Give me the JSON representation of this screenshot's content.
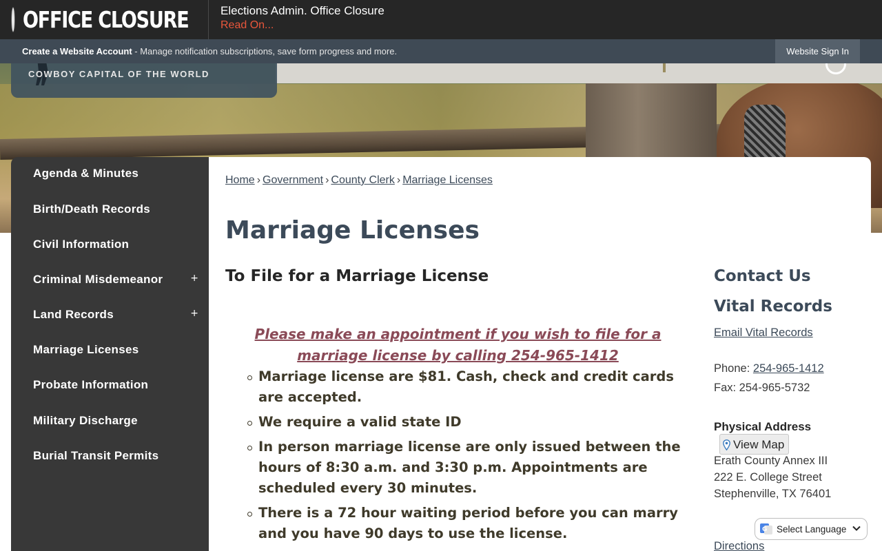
{
  "alert": {
    "title": "OFFICE CLOSURE",
    "headline": "Elections Admin. Office Closure",
    "link": "Read On..."
  },
  "account_bar": {
    "create_label": "Create a Website Account",
    "description": " - Manage notification subscriptions, save form progress and more.",
    "signin_label": "Website Sign In"
  },
  "logo": {
    "tagline": "COWBOY CAPITAL OF THE WORLD"
  },
  "sidebar": {
    "items": [
      {
        "label": "Agenda & Minutes",
        "expandable": false
      },
      {
        "label": "Birth/Death Records",
        "expandable": false
      },
      {
        "label": "Civil Information",
        "expandable": false
      },
      {
        "label": "Criminal Misdemeanor",
        "expandable": true
      },
      {
        "label": "Land Records",
        "expandable": true
      },
      {
        "label": "Marriage Licenses",
        "expandable": false
      },
      {
        "label": "Probate Information",
        "expandable": false
      },
      {
        "label": "Military Discharge",
        "expandable": false
      },
      {
        "label": "Burial Transit Permits",
        "expandable": false
      }
    ],
    "expand_glyph": "+"
  },
  "breadcrumb": {
    "items": [
      "Home",
      "Government",
      "County Clerk",
      "Marriage Licenses"
    ],
    "separator": "›"
  },
  "page": {
    "title": "Marriage Licenses",
    "section_title": "To File for a Marriage License",
    "appointment_notice": "Please make an appointment if you wish to file for a marriage license by calling 254-965-1412",
    "bullets": [
      "Marriage license are $81. Cash, check and credit cards are accepted.",
      "We require a valid state ID",
      "In person marriage license are only issued between the hours of 8:30 a.m. and 3:30 p.m. Appointments are scheduled every 30 minutes.",
      "There is a 72 hour waiting period before you can marry and you have 90 days to use the license."
    ]
  },
  "contact": {
    "title": "Contact Us",
    "department": "Vital Records",
    "email_label": "Email Vital Records",
    "phone_prefix": "Phone: ",
    "phone": "254-965-1412",
    "fax": "Fax: 254-965-5732",
    "address_label": "Physical Address",
    "map_label": "View Map",
    "address_lines": [
      "Erath County Annex III",
      "222 E. College Street",
      "Stephenville, TX 76401"
    ],
    "directions_label": "Directions"
  },
  "language": {
    "label": "Select Language"
  },
  "colors": {
    "alert_bg": "#262626",
    "alert_link": "#e8563b",
    "account_bar": "#3f4a55",
    "sidebar_bg": "#383838",
    "heading": "#3c4a59",
    "appointment": "#8a4a57"
  }
}
